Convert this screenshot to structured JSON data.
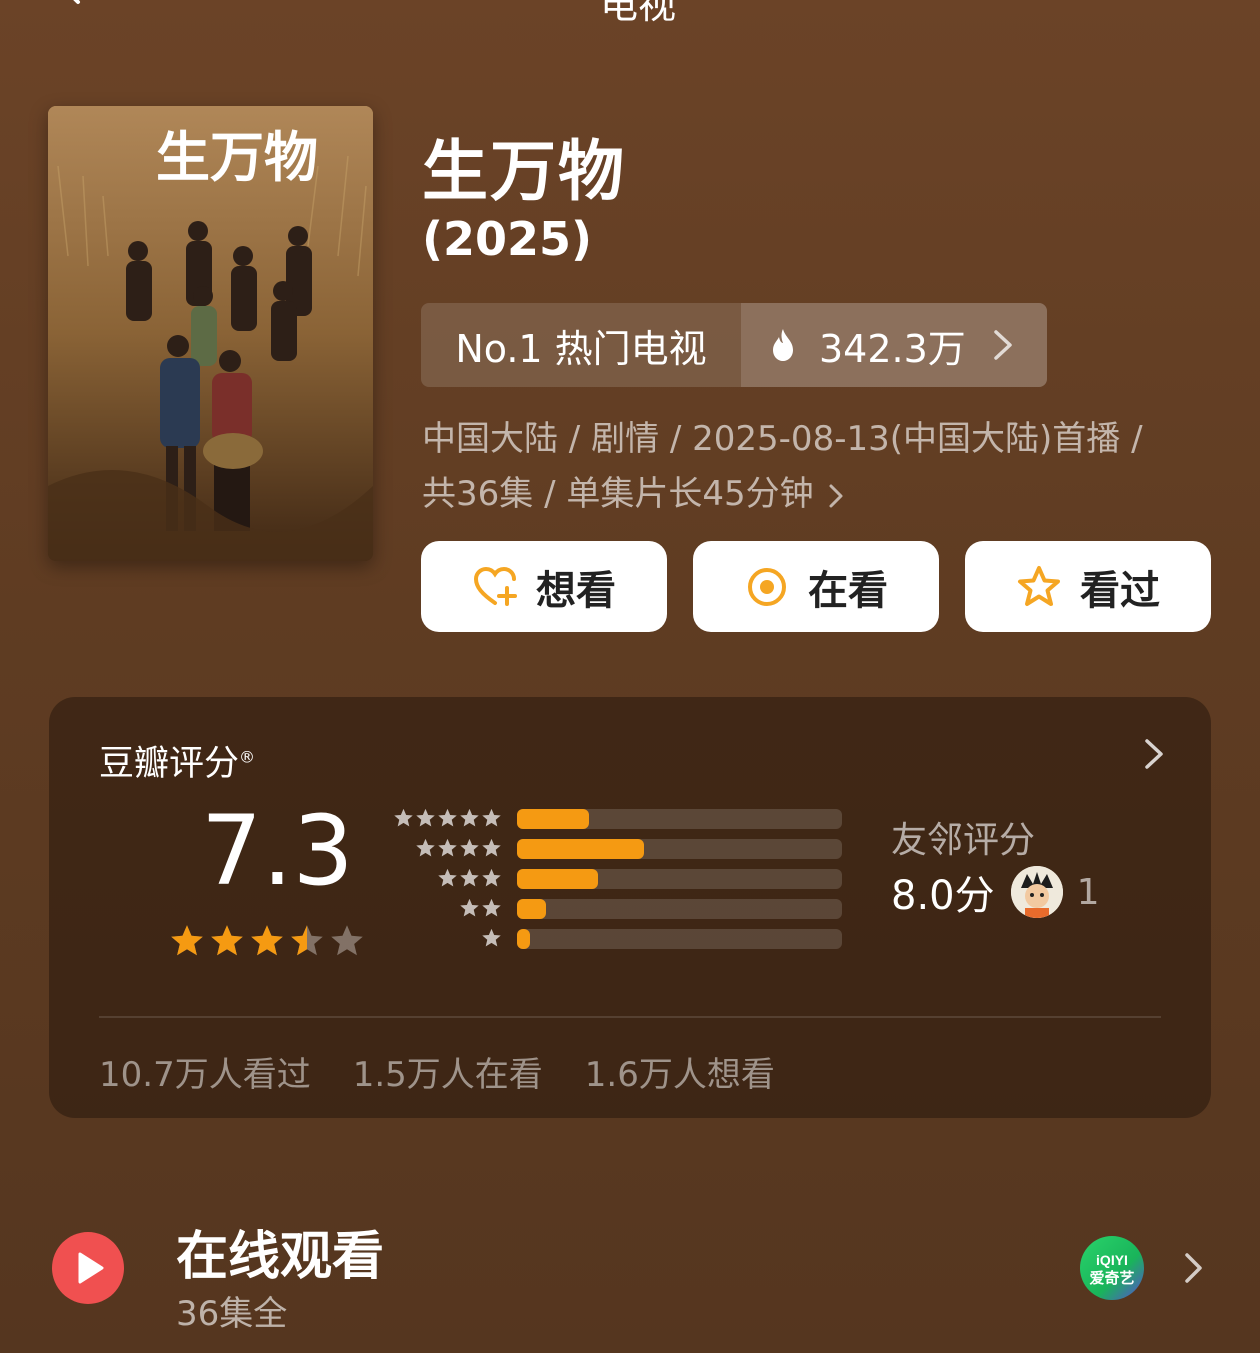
{
  "header": {
    "title": "电视"
  },
  "movie": {
    "title": "生万物",
    "year": "(2025)",
    "rank_label": "No.1 热门电视",
    "heat": "342.3万",
    "meta_line1": "中国大陆 / 剧情 / 2025-08-13(中国大陆)首播 /",
    "meta_line2": "共36集 / 单集片长45分钟",
    "poster_title": "生万物"
  },
  "actions": {
    "want": "想看",
    "watching": "在看",
    "watched": "看过"
  },
  "rating": {
    "label": "豆瓣评分",
    "reg_mark": "®",
    "score": "7.3",
    "stars": 3.5,
    "distribution": [
      {
        "stars": 5,
        "fraction": 0.22
      },
      {
        "stars": 4,
        "fraction": 0.39
      },
      {
        "stars": 3,
        "fraction": 0.25
      },
      {
        "stars": 2,
        "fraction": 0.09
      },
      {
        "stars": 1,
        "fraction": 0.04
      }
    ],
    "friend_label": "友邻评分",
    "friend_score": "8.0分",
    "friend_count": "1",
    "stats": {
      "watched": "10.7万人看过",
      "watching": "1.5万人在看",
      "want": "1.6万人想看"
    }
  },
  "watch_online": {
    "title": "在线观看",
    "subtitle": "36集全",
    "provider_text": "爱奇艺"
  },
  "colors": {
    "accent": "#f59a12",
    "play_red": "#f05050"
  }
}
